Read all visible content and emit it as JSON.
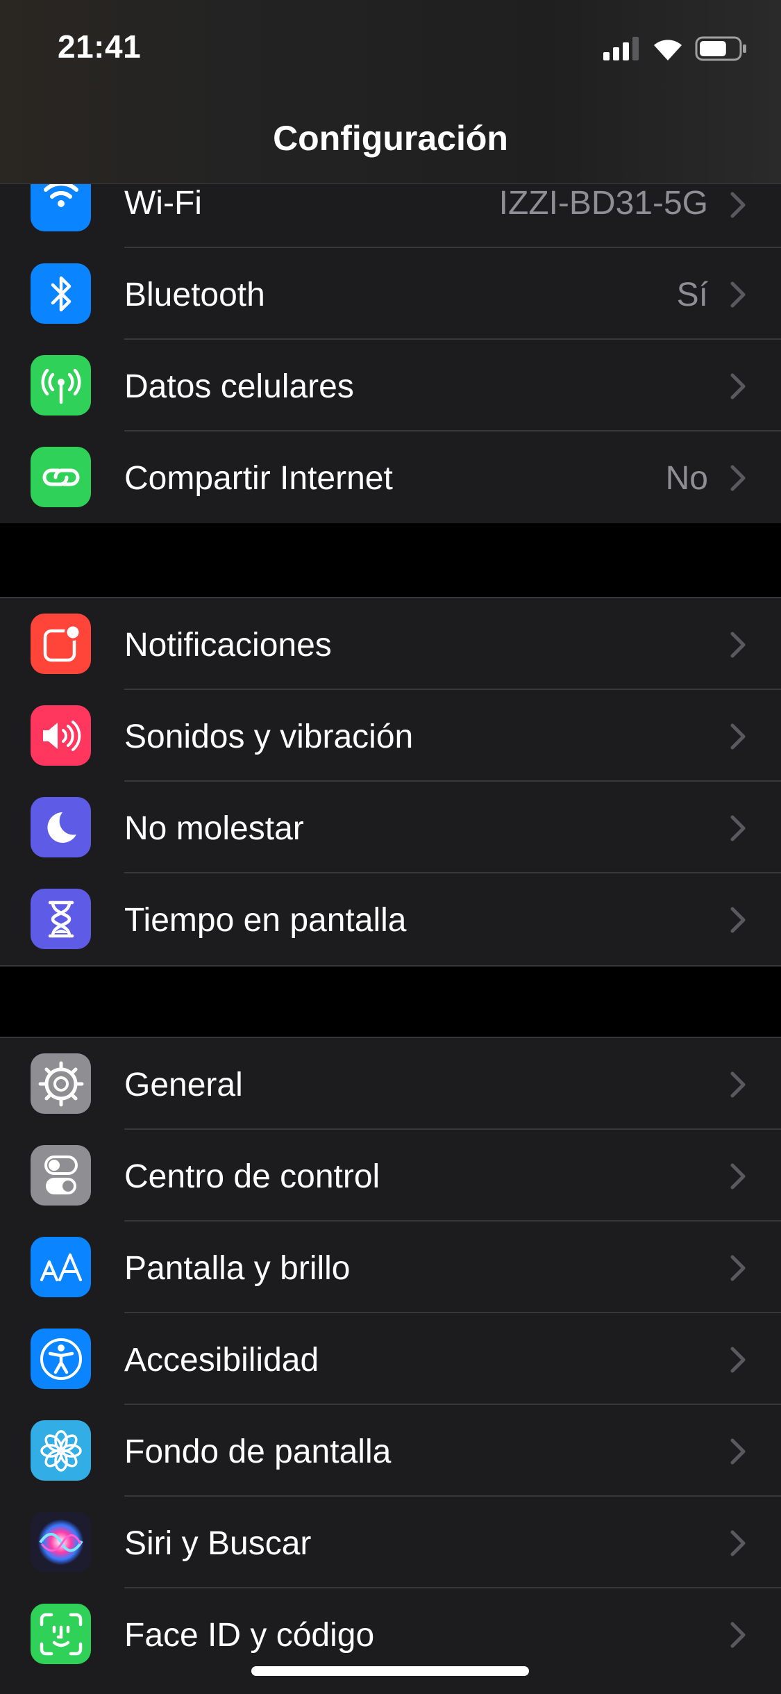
{
  "status_bar": {
    "time": "21:41",
    "battery_level": 0.7
  },
  "nav": {
    "title": "Configuración"
  },
  "groups": [
    {
      "items": [
        {
          "id": "wifi",
          "label": "Wi-Fi",
          "value": "IZZI-BD31-5G",
          "icon": "wifi-icon",
          "color": "#0a84ff"
        },
        {
          "id": "bluetooth",
          "label": "Bluetooth",
          "value": "Sí",
          "icon": "bluetooth-icon",
          "color": "#0a84ff"
        },
        {
          "id": "cellular",
          "label": "Datos celulares",
          "value": "",
          "icon": "antenna-icon",
          "color": "#30d158"
        },
        {
          "id": "hotspot",
          "label": "Compartir Internet",
          "value": "No",
          "icon": "link-icon",
          "color": "#30d158"
        }
      ]
    },
    {
      "items": [
        {
          "id": "notifications",
          "label": "Notificaciones",
          "icon": "notifications-icon",
          "color": "#ff453a"
        },
        {
          "id": "sounds",
          "label": "Sonidos y vibración",
          "icon": "speaker-icon",
          "color": "#ff375f"
        },
        {
          "id": "dnd",
          "label": "No molestar",
          "icon": "moon-icon",
          "color": "#5e5ce6"
        },
        {
          "id": "screentime",
          "label": "Tiempo en pantalla",
          "icon": "hourglass-icon",
          "color": "#5e5ce6"
        }
      ]
    },
    {
      "items": [
        {
          "id": "general",
          "label": "General",
          "icon": "gear-icon",
          "color": "#8e8e93"
        },
        {
          "id": "control",
          "label": "Centro de control",
          "icon": "toggles-icon",
          "color": "#8e8e93"
        },
        {
          "id": "display",
          "label": "Pantalla y brillo",
          "icon": "text-size-icon",
          "color": "#0a84ff"
        },
        {
          "id": "accessibility",
          "label": "Accesibilidad",
          "icon": "accessibility-icon",
          "color": "#0a84ff"
        },
        {
          "id": "wallpaper",
          "label": "Fondo de pantalla",
          "icon": "flower-icon",
          "color": "#32ade6"
        },
        {
          "id": "siri",
          "label": "Siri y Buscar",
          "icon": "siri-icon",
          "color": "#1c1c2e"
        },
        {
          "id": "faceid",
          "label": "Face ID y código",
          "icon": "faceid-icon",
          "color": "#30d158"
        }
      ]
    }
  ]
}
